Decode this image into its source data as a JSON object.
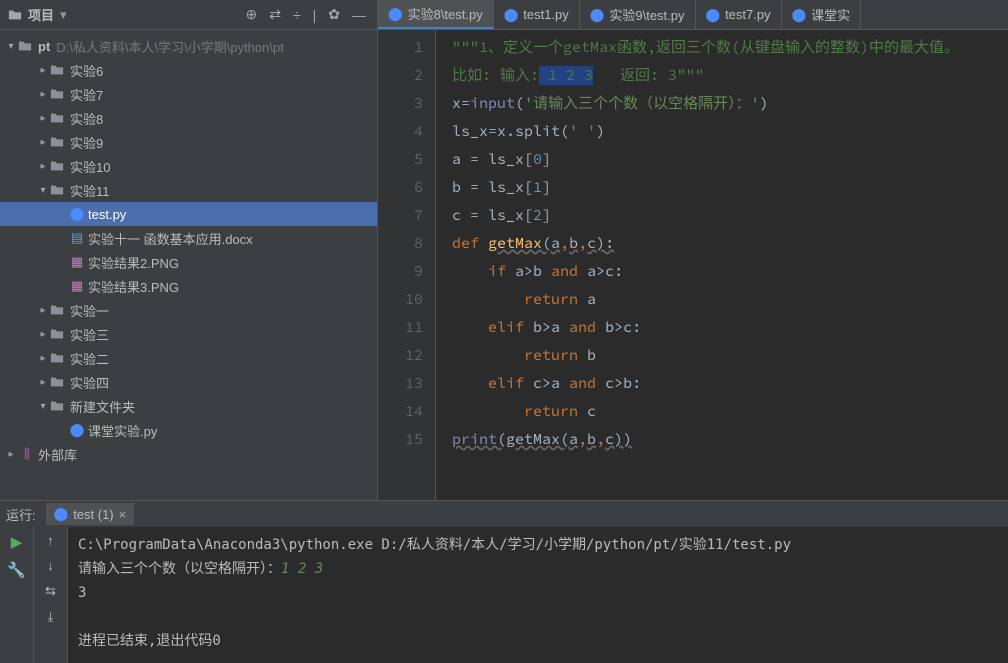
{
  "sidebar": {
    "title": "项目",
    "dropdown": "▾",
    "root": {
      "name": "pt",
      "path": "D:\\私人资料\\本人\\学习\\小学期\\python\\pt"
    },
    "items": [
      {
        "label": "实验6",
        "type": "folder",
        "depth": 2,
        "arrow": "▸"
      },
      {
        "label": "实验7",
        "type": "folder",
        "depth": 2,
        "arrow": "▸"
      },
      {
        "label": "实验8",
        "type": "folder",
        "depth": 2,
        "arrow": "▸"
      },
      {
        "label": "实验9",
        "type": "folder",
        "depth": 2,
        "arrow": "▸"
      },
      {
        "label": "实验10",
        "type": "folder",
        "depth": 2,
        "arrow": "▸"
      },
      {
        "label": "实验11",
        "type": "folder",
        "depth": 2,
        "arrow": "▾"
      },
      {
        "label": "test.py",
        "type": "py",
        "depth": 3,
        "selected": true
      },
      {
        "label": "实验十一 函数基本应用.docx",
        "type": "doc",
        "depth": 3
      },
      {
        "label": "实验结果2.PNG",
        "type": "img",
        "depth": 3
      },
      {
        "label": "实验结果3.PNG",
        "type": "img",
        "depth": 3
      },
      {
        "label": "实验一",
        "type": "folder",
        "depth": 2,
        "arrow": "▸"
      },
      {
        "label": "实验三",
        "type": "folder",
        "depth": 2,
        "arrow": "▸"
      },
      {
        "label": "实验二",
        "type": "folder",
        "depth": 2,
        "arrow": "▸"
      },
      {
        "label": "实验四",
        "type": "folder",
        "depth": 2,
        "arrow": "▸"
      },
      {
        "label": "新建文件夹",
        "type": "folder",
        "depth": 2,
        "arrow": "▾"
      },
      {
        "label": "课堂实验.py",
        "type": "py",
        "depth": 3
      }
    ],
    "external_lib": "外部库"
  },
  "tabs": [
    {
      "label": "实验8\\test.py",
      "active": true
    },
    {
      "label": "test1.py"
    },
    {
      "label": "实验9\\test.py"
    },
    {
      "label": "test7.py"
    },
    {
      "label": "课堂实"
    }
  ],
  "code": {
    "lines": [
      {
        "n": 1,
        "segs": [
          {
            "t": "\"\"\"1、定义一个",
            "c": "tok-str"
          },
          {
            "t": "getMax",
            "c": "tok-str"
          },
          {
            "t": "函数,返回三个数(从键盘输入的整数)中的最大值。",
            "c": "tok-str"
          }
        ]
      },
      {
        "n": 2,
        "segs": [
          {
            "t": "比如: 输入:",
            "c": "tok-str"
          },
          {
            "t": " 1 2 3",
            "c": "tok-str sel-bg"
          },
          {
            "t": "   返回: 3\"\"\"",
            "c": "tok-str"
          }
        ]
      },
      {
        "n": 3,
        "segs": [
          {
            "t": "x",
            "c": ""
          },
          {
            "t": "=",
            "c": "tok-op"
          },
          {
            "t": "input",
            "c": "tok-builtin"
          },
          {
            "t": "(",
            "c": ""
          },
          {
            "t": "'请输入三个个数（以空格隔开）：'",
            "c": "tok-strlit"
          },
          {
            "t": ")",
            "c": ""
          }
        ]
      },
      {
        "n": 4,
        "segs": [
          {
            "t": "ls_x",
            "c": ""
          },
          {
            "t": "=",
            "c": "tok-op"
          },
          {
            "t": "x.split(",
            "c": ""
          },
          {
            "t": "' '",
            "c": "tok-strlit"
          },
          {
            "t": ")",
            "c": ""
          }
        ]
      },
      {
        "n": 5,
        "segs": [
          {
            "t": "a ",
            "c": ""
          },
          {
            "t": "=",
            "c": "tok-op"
          },
          {
            "t": " ls_x[",
            "c": ""
          },
          {
            "t": "0",
            "c": "tok-num"
          },
          {
            "t": "]",
            "c": ""
          }
        ]
      },
      {
        "n": 6,
        "segs": [
          {
            "t": "b ",
            "c": ""
          },
          {
            "t": "=",
            "c": "tok-op"
          },
          {
            "t": " ls_x[",
            "c": ""
          },
          {
            "t": "1",
            "c": "tok-num"
          },
          {
            "t": "]",
            "c": ""
          }
        ]
      },
      {
        "n": 7,
        "segs": [
          {
            "t": "c ",
            "c": ""
          },
          {
            "t": "=",
            "c": "tok-op"
          },
          {
            "t": " ls_x[",
            "c": ""
          },
          {
            "t": "2",
            "c": "tok-num"
          },
          {
            "t": "]",
            "c": ""
          }
        ]
      },
      {
        "n": 8,
        "segs": [
          {
            "t": "def ",
            "c": "tok-kw"
          },
          {
            "t": "getMax",
            "c": "tok-fn tok-und"
          },
          {
            "t": "(a",
            "c": "tok-und"
          },
          {
            "t": ",",
            "c": "tok-kw"
          },
          {
            "t": "b",
            "c": "tok-und"
          },
          {
            "t": ",",
            "c": "tok-kw"
          },
          {
            "t": "c):",
            "c": "tok-und"
          }
        ]
      },
      {
        "n": 9,
        "segs": [
          {
            "t": "    ",
            "c": ""
          },
          {
            "t": "if ",
            "c": "tok-kw"
          },
          {
            "t": "a>b ",
            "c": ""
          },
          {
            "t": "and ",
            "c": "tok-kw"
          },
          {
            "t": "a>c:",
            "c": ""
          }
        ]
      },
      {
        "n": 10,
        "segs": [
          {
            "t": "        ",
            "c": ""
          },
          {
            "t": "return ",
            "c": "tok-kw"
          },
          {
            "t": "a",
            "c": ""
          }
        ]
      },
      {
        "n": 11,
        "segs": [
          {
            "t": "    ",
            "c": ""
          },
          {
            "t": "elif ",
            "c": "tok-kw"
          },
          {
            "t": "b>a ",
            "c": ""
          },
          {
            "t": "and ",
            "c": "tok-kw"
          },
          {
            "t": "b>c:",
            "c": ""
          }
        ]
      },
      {
        "n": 12,
        "segs": [
          {
            "t": "        ",
            "c": ""
          },
          {
            "t": "return ",
            "c": "tok-kw"
          },
          {
            "t": "b",
            "c": ""
          }
        ]
      },
      {
        "n": 13,
        "segs": [
          {
            "t": "    ",
            "c": ""
          },
          {
            "t": "elif ",
            "c": "tok-kw"
          },
          {
            "t": "c>a ",
            "c": ""
          },
          {
            "t": "and ",
            "c": "tok-kw"
          },
          {
            "t": "c>b:",
            "c": ""
          }
        ]
      },
      {
        "n": 14,
        "segs": [
          {
            "t": "        ",
            "c": ""
          },
          {
            "t": "return ",
            "c": "tok-kw"
          },
          {
            "t": "c",
            "c": ""
          }
        ]
      },
      {
        "n": 15,
        "segs": [
          {
            "t": "print",
            "c": "tok-builtin tok-und"
          },
          {
            "t": "(getMax(a",
            "c": "tok-und"
          },
          {
            "t": ",",
            "c": "tok-kw"
          },
          {
            "t": "b",
            "c": "tok-und"
          },
          {
            "t": ",",
            "c": "tok-kw"
          },
          {
            "t": "c))",
            "c": "tok-und"
          }
        ]
      }
    ]
  },
  "console": {
    "run_label": "运行:",
    "tab_label": "test (1)",
    "output_path": "C:\\ProgramData\\Anaconda3\\python.exe D:/私人资料/本人/学习/小学期/python/pt/实验11/test.py",
    "prompt_line_prefix": "请输入三个个数（以空格隔开）：",
    "prompt_input": "1 2 3",
    "result": "3",
    "exit_line": "进程已结束,退出代码0"
  }
}
